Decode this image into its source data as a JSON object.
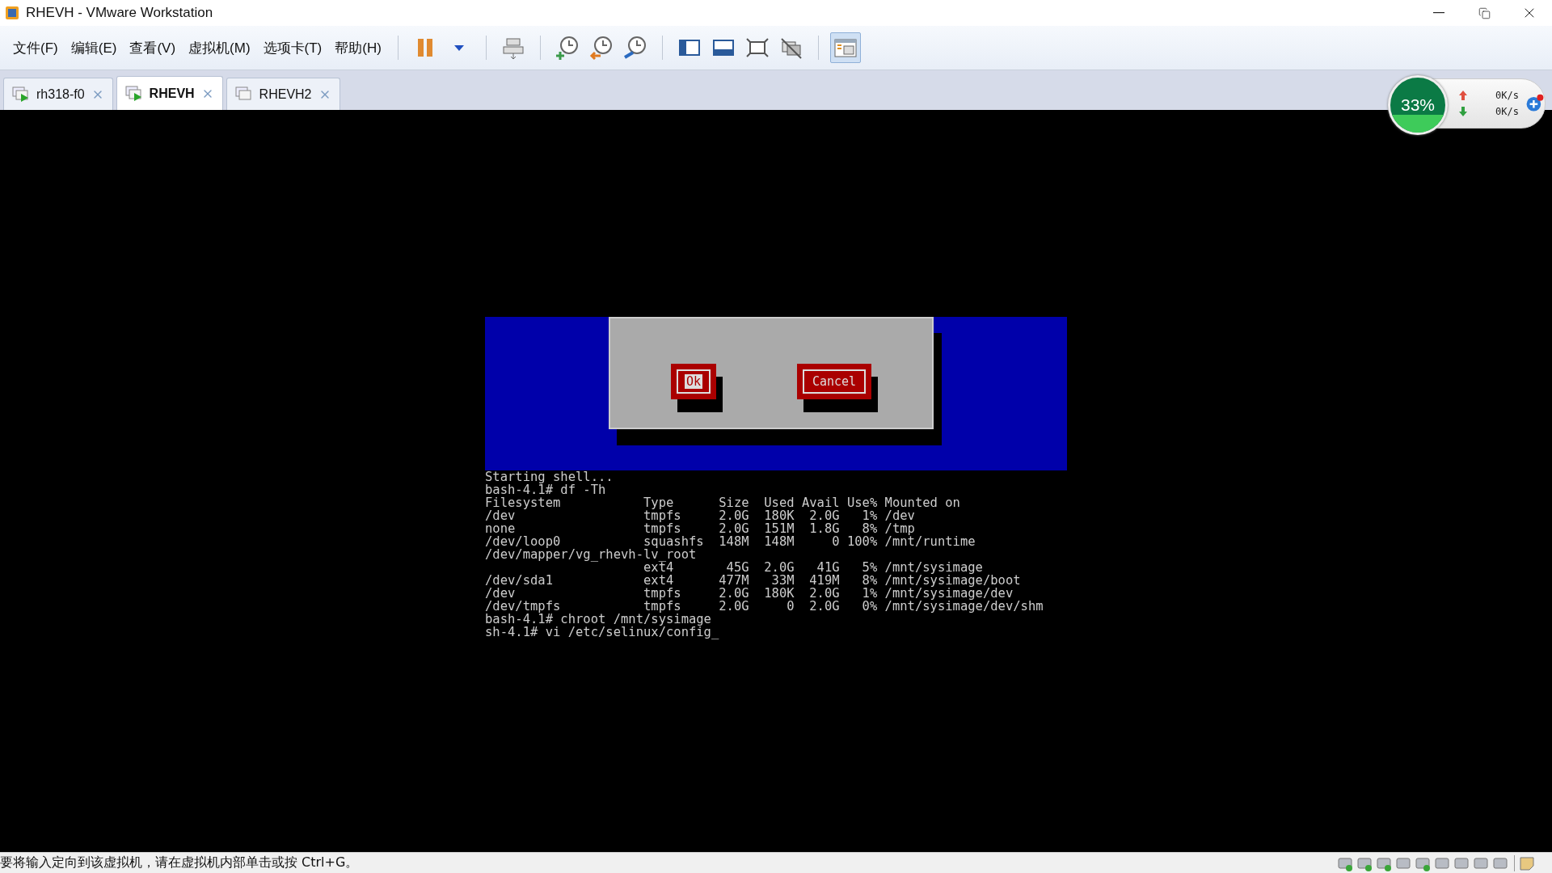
{
  "window": {
    "title": "RHEVH - VMware Workstation"
  },
  "menu": [
    "文件(F)",
    "编辑(E)",
    "查看(V)",
    "虚拟机(M)",
    "选项卡(T)",
    "帮助(H)"
  ],
  "toolbar": {
    "library_toggle_on": true
  },
  "tabs": [
    {
      "label": "rh318-f0",
      "selected": false,
      "running": true
    },
    {
      "label": "RHEVH",
      "selected": true,
      "running": true
    },
    {
      "label": "RHEVH2",
      "selected": false,
      "running": false
    }
  ],
  "speed_widget": {
    "percent": "33%",
    "upload": "0K/s",
    "download": "0K/s"
  },
  "dialog": {
    "buttons": [
      {
        "label": "Ok",
        "selected": true
      },
      {
        "label": "Cancel",
        "selected": false
      }
    ]
  },
  "terminal": {
    "lines": [
      "Starting shell...",
      "bash-4.1# df -Th",
      "Filesystem           Type      Size  Used Avail Use% Mounted on",
      "/dev                 tmpfs     2.0G  180K  2.0G   1% /dev",
      "none                 tmpfs     2.0G  151M  1.8G   8% /tmp",
      "/dev/loop0           squashfs  148M  148M     0 100% /mnt/runtime",
      "/dev/mapper/vg_rhevh-lv_root",
      "                     ext4       45G  2.0G   41G   5% /mnt/sysimage",
      "/dev/sda1            ext4      477M   33M  419M   8% /mnt/sysimage/boot",
      "/dev                 tmpfs     2.0G  180K  2.0G   1% /mnt/sysimage/dev",
      "/dev/tmpfs           tmpfs     2.0G     0  2.0G   0% /mnt/sysimage/dev/shm",
      "bash-4.1# chroot /mnt/sysimage",
      "sh-4.1# vi /etc/selinux/config_"
    ]
  },
  "status_bar": {
    "message": "要将输入定向到该虚拟机，请在虚拟机内部单击或按 Ctrl+G。"
  }
}
